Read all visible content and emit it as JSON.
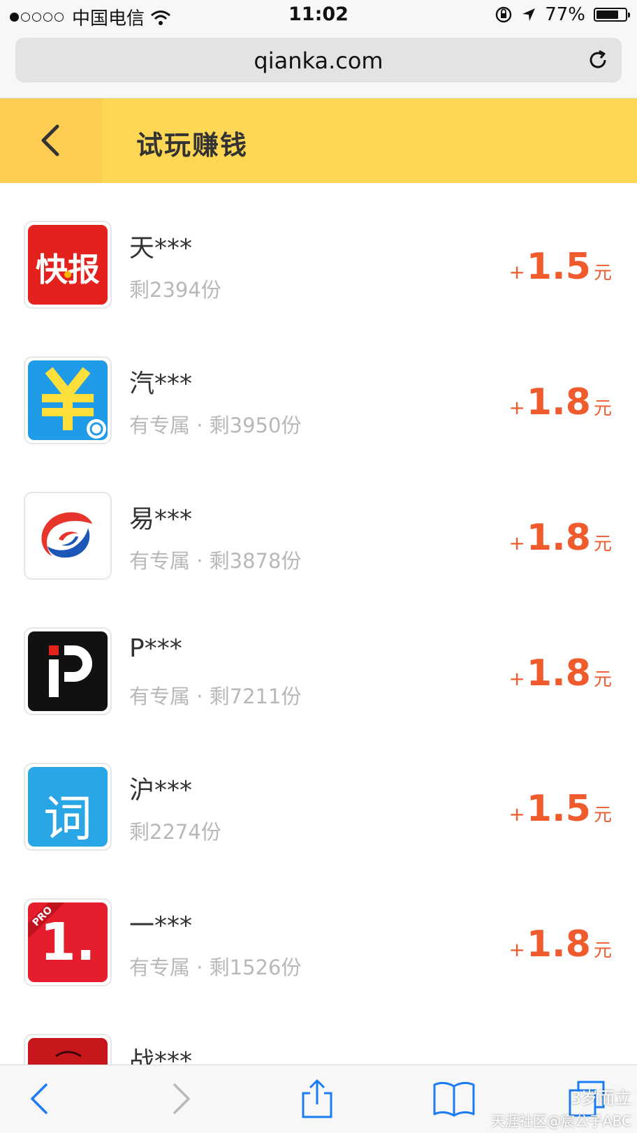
{
  "status": {
    "carrier": "中国电信",
    "time": "11:02",
    "battery": "77%",
    "battery_level": 0.77
  },
  "browser": {
    "url": "qianka.com"
  },
  "header": {
    "title": "试玩赚钱"
  },
  "items": [
    {
      "name": "天***",
      "sub": "剩2394份",
      "plus": "+",
      "amount": "1.5",
      "unit": "元",
      "icon": "kuaibao-icon"
    },
    {
      "name": "汽***",
      "sub": "有专属 · 剩3950份",
      "plus": "+",
      "amount": "1.8",
      "unit": "元",
      "icon": "yuan-car-icon"
    },
    {
      "name": "易***",
      "sub": "有专属 · 剩3878份",
      "plus": "+",
      "amount": "1.8",
      "unit": "元",
      "icon": "swirl-logo-icon"
    },
    {
      "name": "P***",
      "sub": "有专属 · 剩7211份",
      "plus": "+",
      "amount": "1.8",
      "unit": "元",
      "icon": "ip-logo-icon"
    },
    {
      "name": "沪***",
      "sub": "剩2274份",
      "plus": "+",
      "amount": "1.5",
      "unit": "元",
      "icon": "ci-icon"
    },
    {
      "name": "一***",
      "sub": "有专属 · 剩1526份",
      "plus": "+",
      "amount": "1.8",
      "unit": "元",
      "icon": "one-pro-icon"
    },
    {
      "name": "战***",
      "sub": "",
      "plus": "",
      "amount": "",
      "unit": "",
      "icon": "red-game-icon"
    }
  ],
  "icon_texts": {
    "kuaibao": "快报",
    "ci": "词",
    "one": "1.",
    "pro": "PRO"
  },
  "watermark": {
    "line1": "3岁而立",
    "line2": "天涯社区@宸公子ABC"
  }
}
